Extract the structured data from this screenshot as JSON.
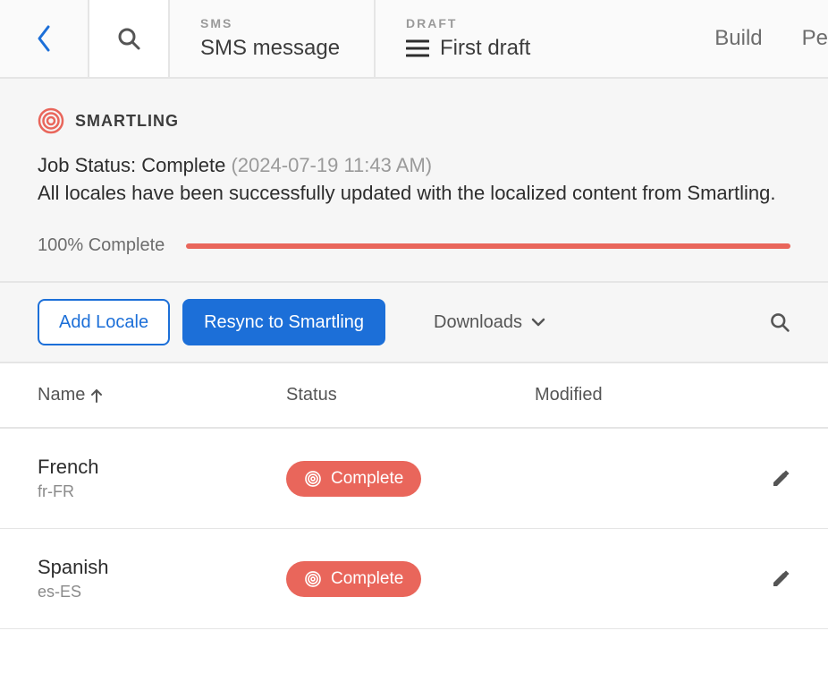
{
  "header": {
    "sms_eyebrow": "SMS",
    "sms_title": "SMS message",
    "draft_eyebrow": "DRAFT",
    "draft_title": "First draft",
    "tab_build": "Build",
    "tab_personalize_clipped": "Pe"
  },
  "brand": {
    "name": "SMARTLING"
  },
  "status": {
    "label": "Job Status:",
    "value": "Complete",
    "timestamp": "(2024-07-19 11:43 AM)",
    "description": "All locales have been successfully updated with the localized content from Smartling.",
    "progress_label": "100% Complete",
    "progress_percent": 100
  },
  "actions": {
    "add_locale": "Add Locale",
    "resync": "Resync to Smartling",
    "downloads": "Downloads"
  },
  "table": {
    "headers": {
      "name": "Name",
      "status": "Status",
      "modified": "Modified"
    },
    "rows": [
      {
        "language": "French",
        "locale": "fr-FR",
        "status": "Complete",
        "modified": ""
      },
      {
        "language": "Spanish",
        "locale": "es-ES",
        "status": "Complete",
        "modified": ""
      }
    ]
  }
}
